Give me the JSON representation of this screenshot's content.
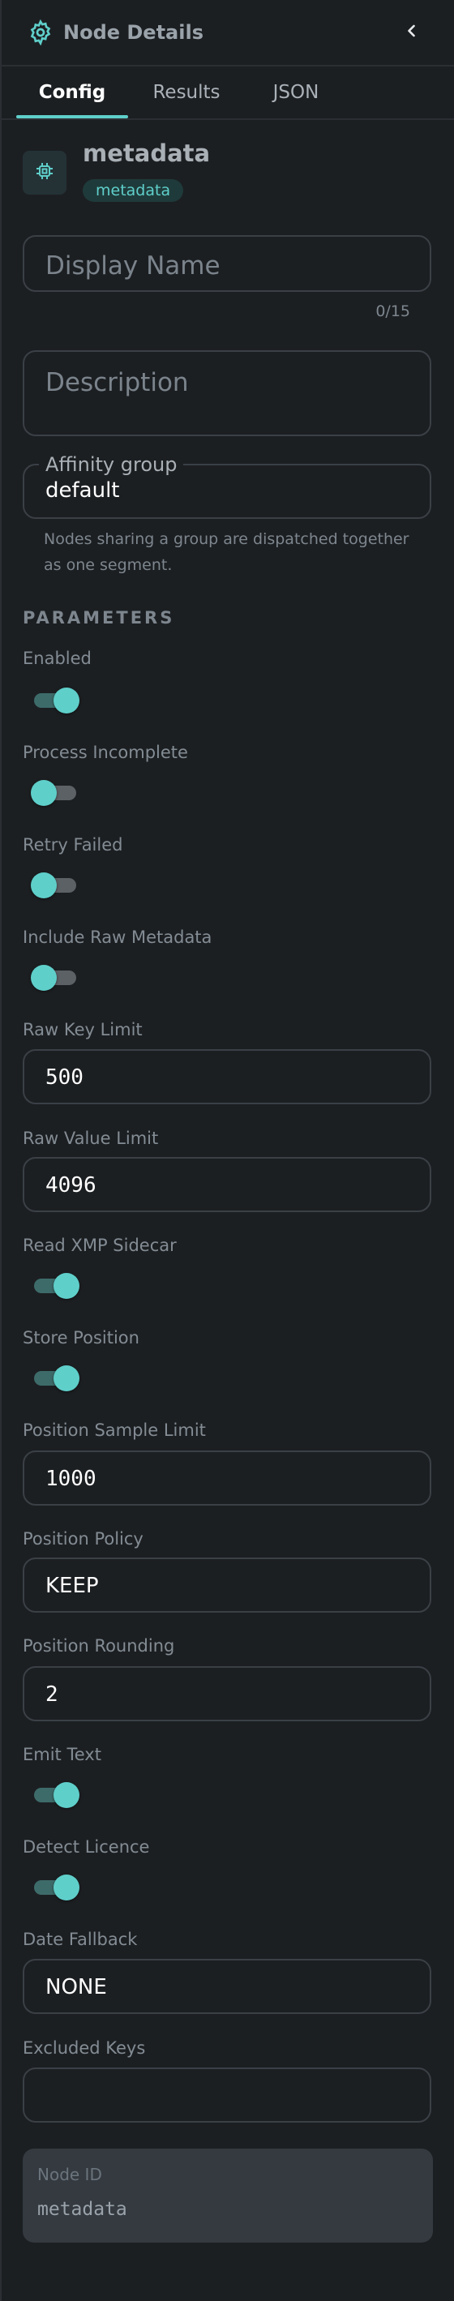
{
  "header": {
    "title": "Node Details",
    "gear_icon": "gear-icon",
    "back_icon": "chevron-left-icon"
  },
  "tabs": [
    {
      "label": "Config",
      "active": true
    },
    {
      "label": "Results",
      "active": false
    },
    {
      "label": "JSON",
      "active": false
    }
  ],
  "node": {
    "name": "metadata",
    "badge": "metadata",
    "icon": "chip-icon"
  },
  "display_name": {
    "placeholder": "Display Name",
    "counter": "0/15"
  },
  "description": {
    "placeholder": "Description"
  },
  "affinity": {
    "label": "Affinity group",
    "value": "default",
    "helper": "Nodes sharing a group are dispatched together as one segment."
  },
  "parameters": {
    "title": "PARAMETERS",
    "enabled": {
      "label": "Enabled",
      "on": true
    },
    "process_incomplete": {
      "label": "Process Incomplete",
      "on": false
    },
    "retry_failed": {
      "label": "Retry Failed",
      "on": false
    },
    "include_raw_metadata": {
      "label": "Include Raw Metadata",
      "on": false
    },
    "raw_key_limit": {
      "label": "Raw Key Limit",
      "value": "500"
    },
    "raw_value_limit": {
      "label": "Raw Value Limit",
      "value": "4096"
    },
    "read_xmp_sidecar": {
      "label": "Read XMP Sidecar",
      "on": true
    },
    "store_position": {
      "label": "Store Position",
      "on": true
    },
    "position_sample_limit": {
      "label": "Position Sample Limit",
      "value": "1000"
    },
    "position_policy": {
      "label": "Position Policy",
      "value": "KEEP"
    },
    "position_rounding": {
      "label": "Position Rounding",
      "value": "2"
    },
    "emit_text": {
      "label": "Emit Text",
      "on": true
    },
    "detect_licence": {
      "label": "Detect Licence",
      "on": true
    },
    "date_fallback": {
      "label": "Date Fallback",
      "value": "NONE"
    },
    "excluded_keys": {
      "label": "Excluded Keys",
      "value": ""
    }
  },
  "node_id": {
    "label": "Node ID",
    "value": "metadata"
  },
  "colors": {
    "accent": "#5fcfca",
    "background": "#1c1f22",
    "border": "#3a4046"
  }
}
